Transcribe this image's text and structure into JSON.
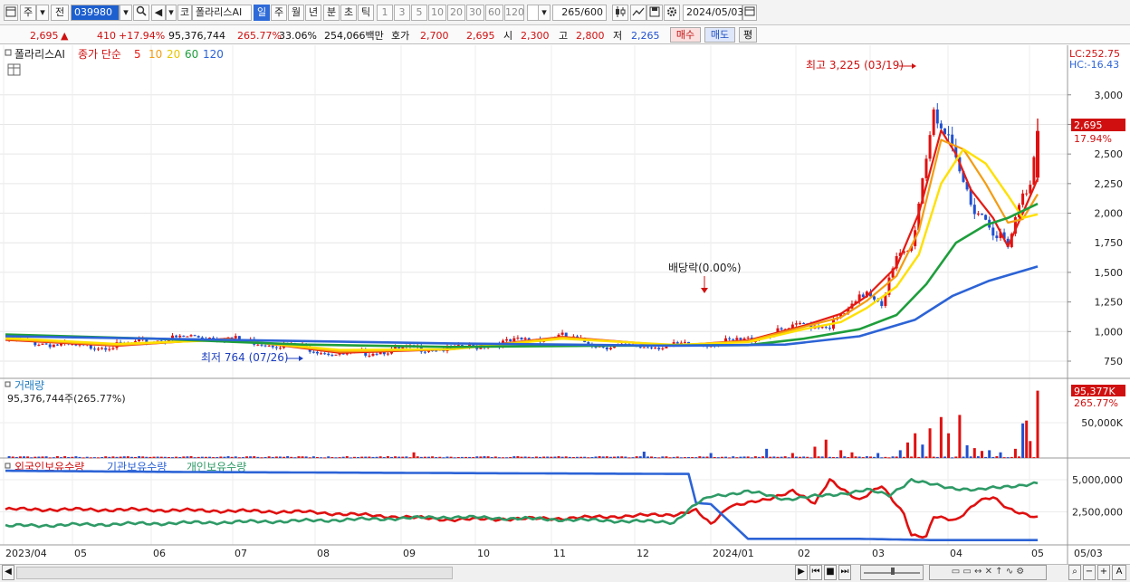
{
  "toolbar": {
    "code_type": "주",
    "market": "전",
    "code": "039980",
    "name_tag": "코",
    "name": "폴라리스AI",
    "periods": [
      "일",
      "주",
      "월",
      "년",
      "분",
      "초",
      "틱"
    ],
    "intervals": [
      "1",
      "3",
      "5",
      "10",
      "20",
      "30",
      "60",
      "120"
    ],
    "count": "265",
    "max": "/600",
    "date": "2024/05/03"
  },
  "info": {
    "price": "2,695",
    "arrow": "▲",
    "change": "410",
    "change_pct": "+17.94%",
    "volume": "95,376,744",
    "volume_pct": "265.77%",
    "turnover_pct": "33.06%",
    "amount": "254,066백만",
    "quote_label": "호가",
    "quote_ask": "2,700",
    "quote_bid": "2,695",
    "open_label": "시",
    "open": "2,300",
    "high_label": "고",
    "high": "2,800",
    "low_label": "저",
    "low": "2,265",
    "buy": "매수",
    "sell": "매도",
    "eval": "평"
  },
  "legend": {
    "stock": "폴라리스AI",
    "ma_label": "종가 단순",
    "ma_periods": [
      "5",
      "10",
      "20",
      "60",
      "120"
    ]
  },
  "status_right": {
    "lc": "LC:252.75",
    "hc": "HC:-16.43"
  },
  "annotations": {
    "high": "최고 3,225 (03/19)",
    "low": "최저 764 (07/26)",
    "dividend": "배당락(0.00%)"
  },
  "price_tag": {
    "price": "2,695",
    "pct": "17.94%"
  },
  "volume_panel": {
    "title": "거래량",
    "summary": "95,376,744주(265.77%)",
    "tag_value": "95,377K",
    "tag_pct": "265.77%"
  },
  "holdings_panel": {
    "legend": [
      "외국인보유수량",
      "기관보유수량",
      "개인보유수량"
    ]
  },
  "colors": {
    "ma5": "#e41b13",
    "ma10": "#f39c12",
    "ma20": "#ffe000",
    "ma60": "#1e9e3c",
    "ma120": "#2c63d6",
    "up": "#e01010",
    "down": "#2050d0",
    "foreign": "#e01010",
    "institution": "#2c63d6",
    "individual": "#2e9a66"
  },
  "chart_data": [
    {
      "type": "candlestick",
      "title": "폴라리스AI",
      "x_ticks": [
        "2023/04",
        "05",
        "06",
        "07",
        "08",
        "09",
        "10",
        "11",
        "12",
        "2024/01",
        "02",
        "03",
        "04",
        "05",
        "05/03"
      ],
      "y_ticks": [
        "750",
        "1,000",
        "1,250",
        "1,500",
        "1,750",
        "2,000",
        "2,250",
        "2,500",
        "2,750",
        "3,000"
      ],
      "y_range": [
        620,
        3350
      ],
      "close_points": [
        [
          0,
          930
        ],
        [
          10,
          900
        ],
        [
          20,
          870
        ],
        [
          30,
          880
        ],
        [
          40,
          920
        ],
        [
          50,
          960
        ],
        [
          60,
          945
        ],
        [
          70,
          900
        ],
        [
          80,
          870
        ],
        [
          90,
          800
        ],
        [
          100,
          830
        ],
        [
          110,
          860
        ],
        [
          120,
          850
        ],
        [
          128,
          880
        ],
        [
          140,
          930
        ],
        [
          150,
          960
        ],
        [
          160,
          880
        ],
        [
          170,
          870
        ],
        [
          180,
          880
        ],
        [
          190,
          900
        ],
        [
          200,
          930
        ],
        [
          210,
          1010
        ],
        [
          215,
          1060
        ],
        [
          222,
          1050
        ],
        [
          228,
          1200
        ],
        [
          232,
          1350
        ],
        [
          236,
          1250
        ],
        [
          240,
          1600
        ],
        [
          244,
          1700
        ],
        [
          246,
          2100
        ],
        [
          250,
          2900
        ],
        [
          252,
          2750
        ],
        [
          256,
          2400
        ],
        [
          260,
          2100
        ],
        [
          264,
          1950
        ],
        [
          268,
          1800
        ],
        [
          270,
          1690
        ],
        [
          273,
          2050
        ],
        [
          276,
          2285
        ],
        [
          278,
          2695
        ]
      ],
      "series": [
        {
          "name": "5",
          "points": [
            [
              0,
              930
            ],
            [
              30,
              880
            ],
            [
              60,
              940
            ],
            [
              90,
              820
            ],
            [
              120,
              850
            ],
            [
              150,
              955
            ],
            [
              180,
              880
            ],
            [
              200,
              925
            ],
            [
              215,
              1050
            ],
            [
              225,
              1150
            ],
            [
              232,
              1300
            ],
            [
              240,
              1550
            ],
            [
              246,
              2000
            ],
            [
              252,
              2700
            ],
            [
              256,
              2500
            ],
            [
              260,
              2200
            ],
            [
              266,
              1960
            ],
            [
              270,
              1720
            ],
            [
              274,
              2000
            ],
            [
              278,
              2290
            ]
          ]
        },
        {
          "name": "10",
          "points": [
            [
              0,
              935
            ],
            [
              30,
              885
            ],
            [
              60,
              935
            ],
            [
              90,
              830
            ],
            [
              120,
              850
            ],
            [
              150,
              950
            ],
            [
              180,
              882
            ],
            [
              200,
              920
            ],
            [
              215,
              1040
            ],
            [
              225,
              1120
            ],
            [
              232,
              1260
            ],
            [
              240,
              1470
            ],
            [
              246,
              1850
            ],
            [
              252,
              2620
            ],
            [
              258,
              2540
            ],
            [
              264,
              2250
            ],
            [
              270,
              1920
            ],
            [
              274,
              1950
            ],
            [
              278,
              2160
            ]
          ]
        },
        {
          "name": "20",
          "points": [
            [
              0,
              945
            ],
            [
              30,
              895
            ],
            [
              60,
              930
            ],
            [
              90,
              845
            ],
            [
              120,
              850
            ],
            [
              150,
              940
            ],
            [
              180,
              888
            ],
            [
              200,
              910
            ],
            [
              215,
              1020
            ],
            [
              225,
              1080
            ],
            [
              232,
              1200
            ],
            [
              240,
              1380
            ],
            [
              246,
              1650
            ],
            [
              252,
              2250
            ],
            [
              258,
              2540
            ],
            [
              264,
              2420
            ],
            [
              270,
              2150
            ],
            [
              274,
              1960
            ],
            [
              278,
              1990
            ]
          ]
        },
        {
          "name": "60",
          "points": [
            [
              0,
              975
            ],
            [
              40,
              940
            ],
            [
              80,
              890
            ],
            [
              120,
              870
            ],
            [
              160,
              880
            ],
            [
              200,
              885
            ],
            [
              215,
              940
            ],
            [
              230,
              1020
            ],
            [
              240,
              1140
            ],
            [
              248,
              1400
            ],
            [
              256,
              1750
            ],
            [
              264,
              1900
            ],
            [
              270,
              1960
            ],
            [
              278,
              2080
            ]
          ]
        },
        {
          "name": "120",
          "points": [
            [
              0,
              960
            ],
            [
              60,
              930
            ],
            [
              120,
              900
            ],
            [
              180,
              880
            ],
            [
              210,
              890
            ],
            [
              230,
              960
            ],
            [
              245,
              1100
            ],
            [
              255,
              1300
            ],
            [
              265,
              1430
            ],
            [
              278,
              1550
            ]
          ]
        }
      ]
    },
    {
      "type": "bar",
      "title": "거래량",
      "y_ticks": [
        "50,000K"
      ],
      "y_range": [
        0,
        100000
      ],
      "tall_bars": [
        [
          110,
          8000
        ],
        [
          172,
          9000
        ],
        [
          190,
          7000
        ],
        [
          205,
          13000
        ],
        [
          212,
          7000
        ],
        [
          218,
          16000
        ],
        [
          221,
          26000
        ],
        [
          225,
          11000
        ],
        [
          228,
          8000
        ],
        [
          235,
          7000
        ],
        [
          241,
          11000
        ],
        [
          243,
          22000
        ],
        [
          245,
          35000
        ],
        [
          247,
          19000
        ],
        [
          249,
          42000
        ],
        [
          252,
          58000
        ],
        [
          254,
          35000
        ],
        [
          257,
          61000
        ],
        [
          259,
          18000
        ],
        [
          261,
          14000
        ],
        [
          263,
          10000
        ],
        [
          265,
          11000
        ],
        [
          268,
          8000
        ],
        [
          272,
          13000
        ],
        [
          274,
          49000
        ],
        [
          275,
          53000
        ],
        [
          276,
          24000
        ],
        [
          278,
          95377
        ]
      ]
    },
    {
      "type": "line",
      "title": "외국인보유수량 / 기관보유수량 / 개인보유수량",
      "y_ticks": [
        "2,500,000",
        "5,000,000"
      ],
      "y_range": [
        0,
        6200000
      ],
      "series": [
        {
          "name": "외국인보유수량",
          "points": [
            [
              0,
              2700000
            ],
            [
              40,
              2650000
            ],
            [
              80,
              2500000
            ],
            [
              120,
              1900000
            ],
            [
              150,
              2000000
            ],
            [
              180,
              2300000
            ],
            [
              186,
              2600000
            ],
            [
              190,
              1500000
            ],
            [
              195,
              3000000
            ],
            [
              205,
              3400000
            ],
            [
              212,
              4200000
            ],
            [
              218,
              3100000
            ],
            [
              222,
              5000000
            ],
            [
              230,
              3400000
            ],
            [
              236,
              4500000
            ],
            [
              242,
              2400000
            ],
            [
              244,
              700000
            ],
            [
              248,
              500000
            ],
            [
              250,
              2100000
            ],
            [
              256,
              1900000
            ],
            [
              262,
              3300000
            ],
            [
              266,
              3600000
            ],
            [
              270,
              2800000
            ],
            [
              276,
              2200000
            ],
            [
              278,
              2000000
            ]
          ]
        },
        {
          "name": "기관보유수량",
          "points": [
            [
              0,
              5700000
            ],
            [
              50,
              5600000
            ],
            [
              138,
              5500000
            ],
            [
              184,
              5450000
            ],
            [
              186,
              3200000
            ],
            [
              190,
              3100000
            ],
            [
              200,
              400000
            ],
            [
              230,
              400000
            ],
            [
              250,
              300000
            ],
            [
              278,
              300000
            ]
          ]
        },
        {
          "name": "개인보유수량",
          "points": [
            [
              0,
              1400000
            ],
            [
              40,
              1600000
            ],
            [
              80,
              1800000
            ],
            [
              120,
              2100000
            ],
            [
              150,
              1900000
            ],
            [
              180,
              1700000
            ],
            [
              186,
              3100000
            ],
            [
              190,
              3700000
            ],
            [
              200,
              4100000
            ],
            [
              210,
              3500000
            ],
            [
              222,
              3800000
            ],
            [
              232,
              4200000
            ],
            [
              238,
              3800000
            ],
            [
              244,
              5000000
            ],
            [
              248,
              4700000
            ],
            [
              254,
              4400000
            ],
            [
              262,
              4200000
            ],
            [
              270,
              4500000
            ],
            [
              278,
              4700000
            ]
          ]
        }
      ]
    }
  ]
}
